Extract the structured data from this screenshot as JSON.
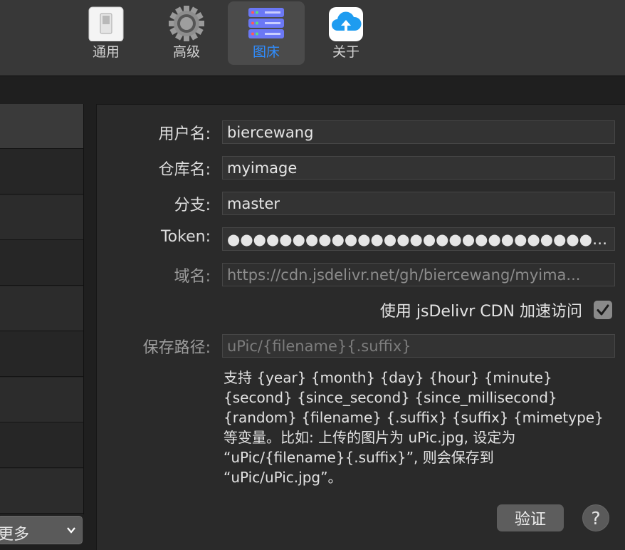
{
  "toolbar": {
    "tabs": [
      {
        "label": "通用",
        "icon": "switch-icon"
      },
      {
        "label": "高级",
        "icon": "gear-icon"
      },
      {
        "label": "图床",
        "icon": "server-icon",
        "active": true
      },
      {
        "label": "关于",
        "icon": "upload-cloud-icon"
      }
    ]
  },
  "sidebar": {
    "more_select": "更多"
  },
  "form": {
    "username_label": "用户名:",
    "username_value": "biercewang",
    "repo_label": "仓库名:",
    "repo_value": "myimage",
    "branch_label": "分支:",
    "branch_value": "master",
    "token_label": "Token:",
    "token_value": "●●●●●●●●●●●●●●●●●●●●●●●●●●●●●●●●●●●...",
    "domain_label": "域名:",
    "domain_value": "https://cdn.jsdelivr.net/gh/biercewang/myima...",
    "cdn_label": "使用 jsDelivr CDN 加速访问",
    "cdn_checked": true,
    "path_label": "保存路径:",
    "path_placeholder": "uPic/{filename}{.suffix}",
    "help": "支持 {year} {month} {day} {hour} {minute} {second} {since_second} {since_millisecond} {random} {filename} {.suffix} {suffix} {mimetype} 等变量。比如: 上传的图片为 uPic.jpg, 设定为 “uPic/{filename}{.suffix}”, 则会保存到 “uPic/uPic.jpg”。"
  },
  "actions": {
    "verify_label": "验证",
    "help_label": "?"
  },
  "colors": {
    "accent": "#2f8dff",
    "background": "#1f1f1f",
    "panel": "#2a2a2a"
  }
}
